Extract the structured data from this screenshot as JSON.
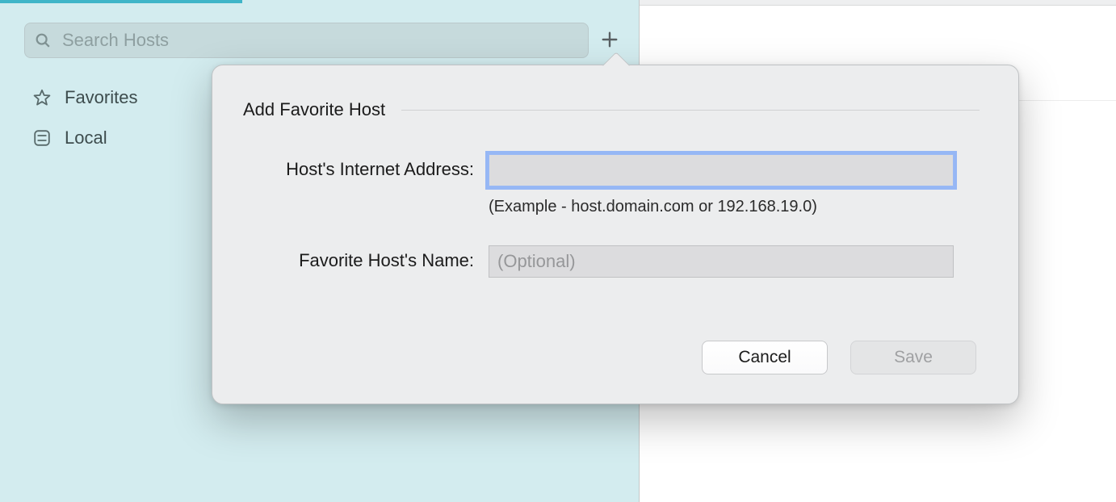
{
  "sidebar": {
    "search_placeholder": "Search Hosts",
    "items": [
      {
        "label": "Favorites"
      },
      {
        "label": "Local"
      }
    ]
  },
  "popover": {
    "title": "Add Favorite Host",
    "address_label": "Host's Internet Address:",
    "address_value": "",
    "address_example": "(Example - host.domain.com or 192.168.19.0)",
    "name_label": "Favorite Host's Name:",
    "name_placeholder": "(Optional)",
    "name_value": "",
    "cancel_label": "Cancel",
    "save_label": "Save"
  }
}
